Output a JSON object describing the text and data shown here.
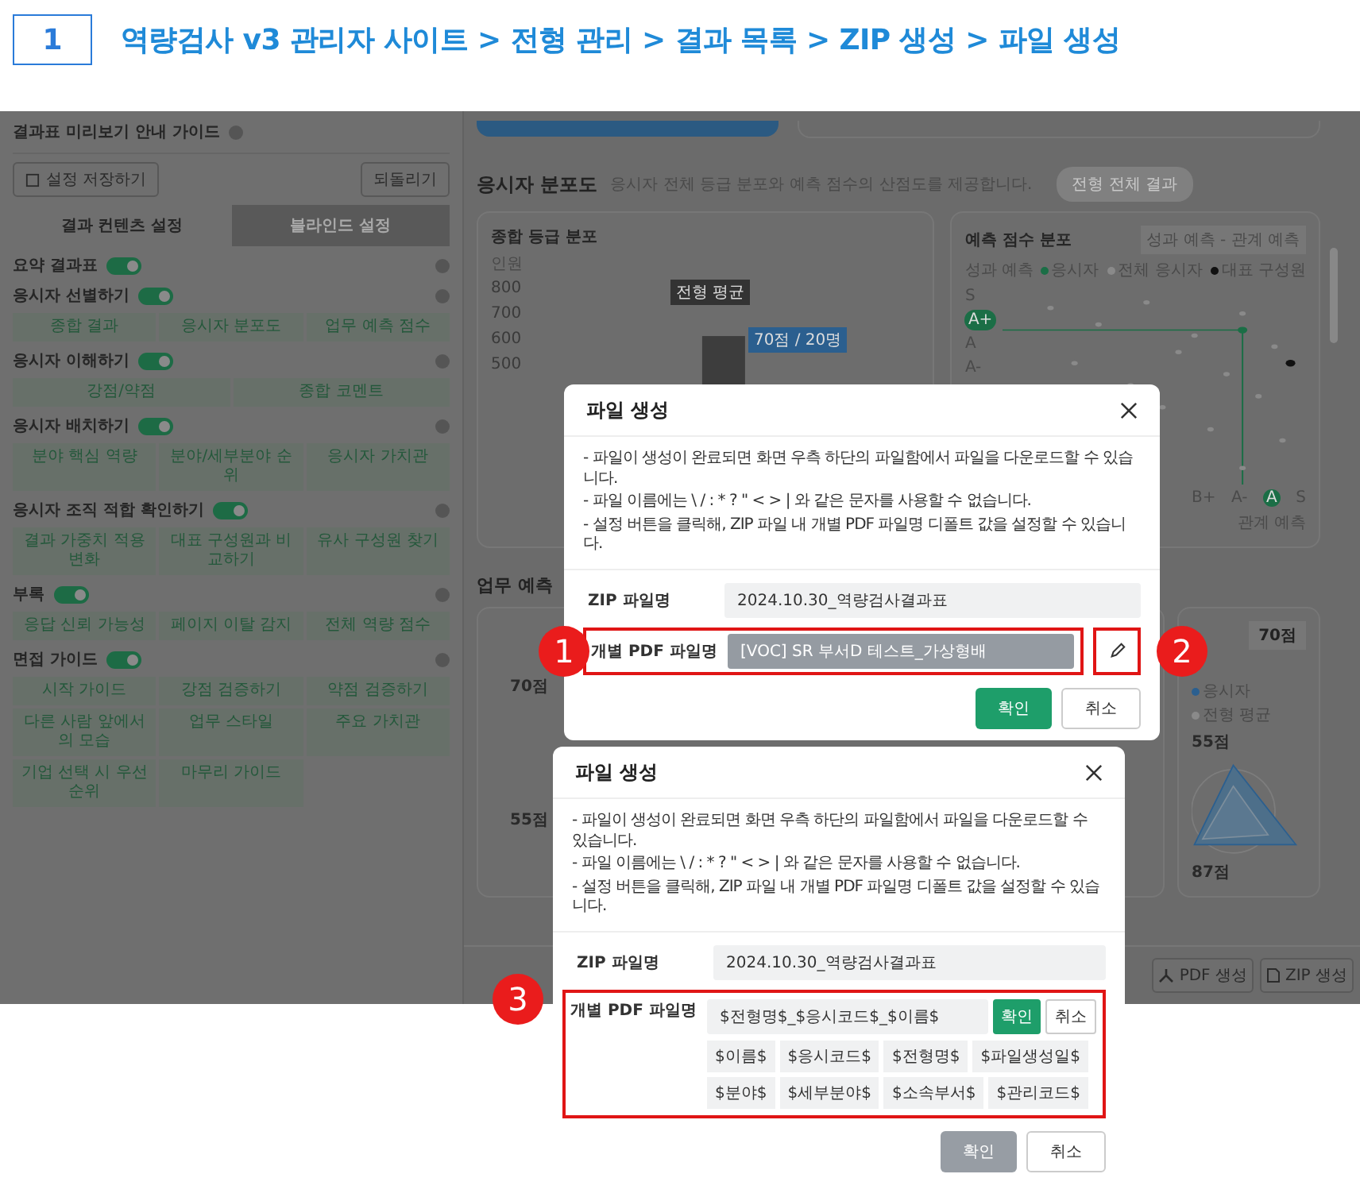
{
  "header": {
    "step": "1",
    "title": "역량검사 v3 관리자 사이트 > 전형 관리 > 결과 목록 > ZIP 생성 > 파일 생성"
  },
  "guide_panel": {
    "title": "결과표 미리보기 안내 가이드",
    "save_button": "설정 저장하기",
    "reset_button": "되돌리기",
    "tabs": [
      {
        "label": "결과 컨텐츠 설정",
        "selected": true
      },
      {
        "label": "블라인드 설정",
        "selected": false
      }
    ],
    "sections": [
      {
        "label": "요약 결과표",
        "on": true
      },
      {
        "label": "응시자 선별하기",
        "on": true,
        "chips": [
          "종합 결과",
          "응시자 분포도",
          "업무 예측 점수"
        ]
      },
      {
        "label": "응시자 이해하기",
        "on": true,
        "chips": [
          "강점/약점",
          "종합 코멘트"
        ]
      },
      {
        "label": "응시자 배치하기",
        "on": true,
        "chips": [
          "분야 핵심 역량",
          "분야/세부분야 순위",
          "응시자 가치관"
        ]
      },
      {
        "label": "응시자 조직 적합 확인하기",
        "on": true,
        "chips": [
          "결과 가중치 적용 변화",
          "대표 구성원과 비교하기",
          "유사 구성원 찾기"
        ]
      },
      {
        "label": "부록",
        "on": true,
        "chips": [
          "응답 신뢰 가능성",
          "페이지 이탈 감지",
          "전체 역량 점수"
        ]
      },
      {
        "label": "면접 가이드",
        "on": true,
        "chips": [
          "시작 가이드",
          "강점 검증하기",
          "약점 검증하기",
          "다른 사람 앞에서의 모습",
          "업무 스타일",
          "주요 가치관",
          "기업 선택 시 우선순위",
          "마무리 가이드"
        ]
      }
    ]
  },
  "distribution": {
    "title": "응시자 분포도",
    "description": "응시자 전체 등급 분포와 예측 점수의 산점도를 제공합니다.",
    "button": "전형 전체 결과",
    "grade_chart": {
      "title": "종합 등급 분포",
      "unit": "인원",
      "yticks": [
        "800",
        "700",
        "600",
        "500"
      ],
      "average_tag": "전형 평균",
      "value_tag": "70점 / 20명"
    },
    "score_chart": {
      "title": "예측 점수 분포",
      "filter": "성과 예측 - 관계 예측",
      "axis_title": "성과 예측",
      "legend": [
        {
          "label": "응시자",
          "color": "#1b6e46"
        },
        {
          "label": "전체 응시자",
          "color": "#8a8a8a"
        },
        {
          "label": "대표 구성원",
          "color": "#111111"
        }
      ],
      "grades": [
        {
          "label": "S",
          "selected": false
        },
        {
          "label": "A+",
          "selected": true
        },
        {
          "label": "A",
          "selected": false
        },
        {
          "label": "A-",
          "selected": false
        }
      ],
      "xgrades": [
        {
          "label": "B+",
          "selected": false
        },
        {
          "label": "A-",
          "selected": false
        },
        {
          "label": "A",
          "selected": true
        },
        {
          "label": "S",
          "selected": false
        }
      ],
      "xaxis_title": "관계 예측"
    }
  },
  "prediction": {
    "title": "업무 예측",
    "left_scores": [
      "70점",
      "55점"
    ],
    "badge": "70점",
    "legend": [
      {
        "label": "응시자",
        "color": "#2b5f8f"
      },
      {
        "label": "전형 평균",
        "color": "#8a8a8a"
      }
    ],
    "right_scores": [
      "55점",
      "87점"
    ]
  },
  "footer_buttons": [
    {
      "label": "PDF 생성",
      "kind": "pdf"
    },
    {
      "label": "ZIP 생성",
      "kind": "zip"
    }
  ],
  "dialogs": [
    {
      "title": "파일 생성",
      "notes": [
        "- 파일이 생성이 완료되면 화면 우측 하단의 파일함에서 파일을 다운로드할 수 있습니다.",
        "- 파일 이름에는 \\ / : * ? \" < > | 와 같은 문자를 사용할 수 없습니다.",
        "- 설정 버튼을 클릭해, ZIP 파일 내 개별 PDF 파일명 디폴트 값을 설정할 수 있습니다."
      ],
      "zip_label": "ZIP 파일명",
      "zip_value": "2024.10.30_역량검사결과표",
      "pdf_label": "개별 PDF 파일명",
      "pdf_value": "[VOC] SR 부서D 테스트_가상형배",
      "editing": false,
      "confirm": "확인",
      "cancel": "취소",
      "confirm_disabled": false,
      "callouts": [
        "1",
        "2"
      ]
    },
    {
      "title": "파일 생성",
      "notes": [
        "- 파일이 생성이 완료되면 화면 우측 하단의 파일함에서 파일을 다운로드할 수 있습니다.",
        "- 파일 이름에는 \\ / : * ? \" < > | 와 같은 문자를 사용할 수 없습니다.",
        "- 설정 버튼을 클릭해, ZIP 파일 내 개별 PDF 파일명 디폴트 값을 설정할 수 있습니다."
      ],
      "zip_label": "ZIP 파일명",
      "zip_value": "2024.10.30_역량검사결과표",
      "pdf_label": "개별 PDF 파일명",
      "pdf_value": "$전형명$_$응시코드$_$이름$",
      "editing": true,
      "inline_confirm": "확인",
      "inline_cancel": "취소",
      "tokens": [
        "$이름$",
        "$응시코드$",
        "$전형명$",
        "$파일생성일$",
        "$분야$",
        "$세부분야$",
        "$소속부서$",
        "$관리코드$"
      ],
      "confirm": "확인",
      "cancel": "취소",
      "confirm_disabled": true,
      "callouts": [
        "3"
      ]
    }
  ]
}
